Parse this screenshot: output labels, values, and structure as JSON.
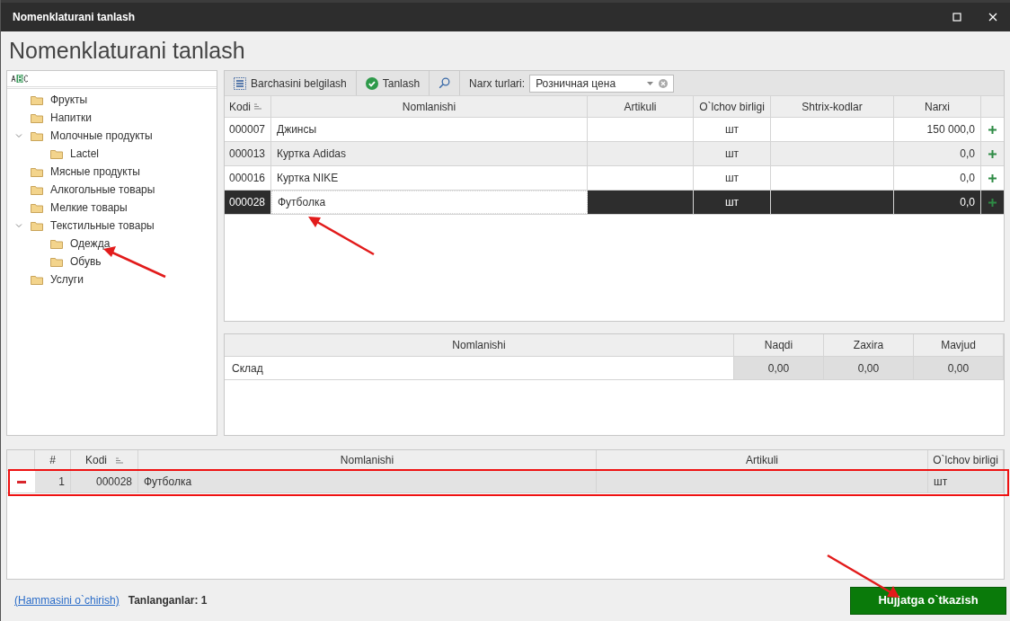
{
  "window": {
    "title": "Nomenklaturani tanlash"
  },
  "heading": "Nomenklaturani tanlash",
  "tree": {
    "items": [
      {
        "label": "Фрукты"
      },
      {
        "label": "Напитки"
      },
      {
        "label": "Молочные продукты",
        "expanded": true,
        "children": [
          {
            "label": "Lactel"
          }
        ]
      },
      {
        "label": "Мясные продукты"
      },
      {
        "label": "Алкогольные товары"
      },
      {
        "label": "Мелкие товары"
      },
      {
        "label": "Текстильные товары",
        "expanded": true,
        "children": [
          {
            "label": "Одежда"
          },
          {
            "label": "Обувь"
          }
        ]
      },
      {
        "label": "Услуги"
      }
    ]
  },
  "toolbar": {
    "select_all": "Barchasini belgilash",
    "choose": "Tanlash",
    "price_label": "Narx turlari:",
    "price_value": "Розничная цена"
  },
  "products": {
    "columns": [
      "Kodi",
      "Nomlanishi",
      "Artikuli",
      "O`lchov birligi",
      "Shtrix-kodlar",
      "Narxi"
    ],
    "rows": [
      {
        "cells": [
          "000007",
          "Джинсы",
          "",
          "шт",
          "",
          "150 000,0"
        ],
        "selected": false
      },
      {
        "cells": [
          "000013",
          "Куртка Adidas",
          "",
          "шт",
          "",
          "0,0"
        ],
        "selected": false
      },
      {
        "cells": [
          "000016",
          "Куртка NIKE",
          "",
          "шт",
          "",
          "0,0"
        ],
        "selected": false
      },
      {
        "cells": [
          "000028",
          "Футболка",
          "",
          "шт",
          "",
          "0,0"
        ],
        "selected": true
      }
    ]
  },
  "stock": {
    "columns": [
      "Nomlanishi",
      "Naqdi",
      "Zaxira",
      "Mavjud"
    ],
    "rows": [
      {
        "cells": [
          "Склад",
          "0,00",
          "0,00",
          "0,00"
        ]
      }
    ]
  },
  "chosen": {
    "columns": [
      "#",
      "Kodi",
      "Nomlanishi",
      "Artikuli",
      "O`lchov birligi"
    ],
    "rows": [
      {
        "cells": [
          "1",
          "000028",
          "Футболка",
          "",
          "шт"
        ]
      }
    ]
  },
  "footer": {
    "clear_link": "(Hammasini o`chirish)",
    "count": "Tanlanganlar: 1",
    "submit": "Hujjatga o`tkazish"
  }
}
